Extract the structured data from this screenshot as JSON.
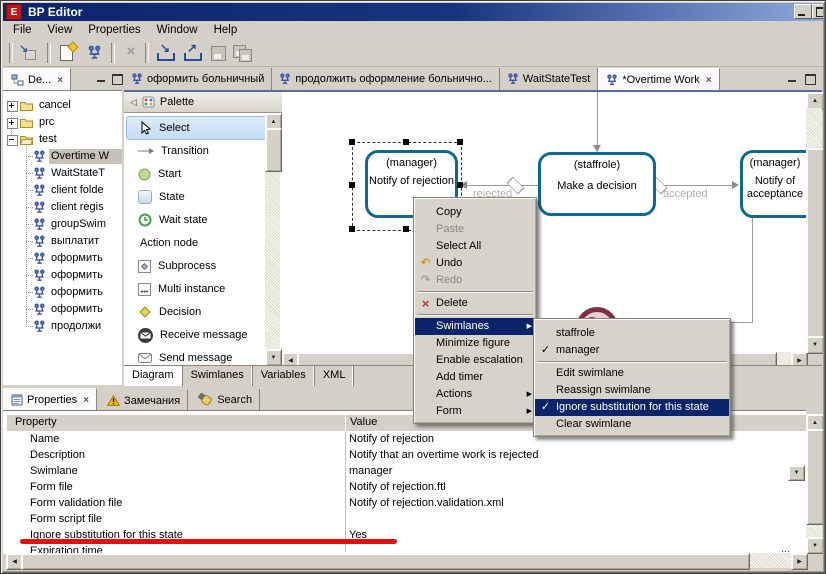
{
  "window": {
    "title": "BP Editor",
    "icon_text": "E"
  },
  "menubar": {
    "items": [
      "File",
      "View",
      "Properties",
      "Window",
      "Help"
    ]
  },
  "toolbar": {
    "icons": [
      "navigate",
      "new-file",
      "new-process",
      "delete",
      "import",
      "export",
      "save",
      "save-all"
    ]
  },
  "explorer": {
    "tab_label": "De...",
    "items": [
      {
        "label": "cancel",
        "type": "folder"
      },
      {
        "label": "prc",
        "type": "folder"
      },
      {
        "label": "test",
        "type": "folder"
      },
      {
        "label": "Overtime W",
        "type": "process"
      },
      {
        "label": "WaitStateT",
        "type": "process"
      },
      {
        "label": "client folde",
        "type": "process"
      },
      {
        "label": "client regis",
        "type": "process"
      },
      {
        "label": "groupSwim",
        "type": "process"
      },
      {
        "label": "выплатит",
        "type": "process"
      },
      {
        "label": "оформить",
        "type": "process"
      },
      {
        "label": "оформить",
        "type": "process"
      },
      {
        "label": "оформить",
        "type": "process"
      },
      {
        "label": "оформить",
        "type": "process"
      },
      {
        "label": "продолжи",
        "type": "process"
      }
    ]
  },
  "editor": {
    "tabs": [
      {
        "label": "оформить больничный"
      },
      {
        "label": "продолжить оформление больнично..."
      },
      {
        "label": "WaitStateTest"
      },
      {
        "label": "*Overtime Work"
      }
    ],
    "bottom_tabs": [
      {
        "label": "Diagram"
      },
      {
        "label": "Swimlanes"
      },
      {
        "label": "Variables"
      },
      {
        "label": "XML"
      }
    ]
  },
  "palette": {
    "title": "Palette",
    "items": [
      {
        "label": "Select"
      },
      {
        "label": "Transition"
      },
      {
        "label": "Start"
      },
      {
        "label": "State"
      },
      {
        "label": "Wait state"
      },
      {
        "label": "Action node"
      },
      {
        "label": "Subprocess"
      },
      {
        "label": "Multi instance"
      },
      {
        "label": "Decision"
      },
      {
        "label": "Receive message"
      },
      {
        "label": "Send message"
      }
    ]
  },
  "diagram": {
    "nodes": [
      {
        "swimlane": "(manager)",
        "name": "Notify of rejection"
      },
      {
        "swimlane": "(staffrole)",
        "name": "Make a decision"
      },
      {
        "swimlane": "(manager)",
        "name": "Notify of acceptance"
      }
    ],
    "transition_labels": {
      "rejected": "rejected",
      "accepted": "accepted"
    }
  },
  "context_menu": {
    "items": [
      {
        "label": "Copy"
      },
      {
        "label": "Paste"
      },
      {
        "label": "Select All"
      },
      {
        "label": "Undo"
      },
      {
        "label": "Redo"
      },
      {
        "label": "Delete"
      },
      {
        "label": "Swimlanes"
      },
      {
        "label": "Minimize figure"
      },
      {
        "label": "Enable escalation"
      },
      {
        "label": "Add timer"
      },
      {
        "label": "Actions"
      },
      {
        "label": "Form"
      }
    ]
  },
  "swimlanes_submenu": {
    "items": [
      {
        "label": "staffrole"
      },
      {
        "label": "manager"
      },
      {
        "label": "Edit swimlane"
      },
      {
        "label": "Reassign swimlane"
      },
      {
        "label": "Ignore substitution for this state"
      },
      {
        "label": "Clear swimlane"
      }
    ]
  },
  "properties_panel": {
    "tabs": [
      {
        "label": "Properties"
      },
      {
        "label": "Замечания"
      },
      {
        "label": "Search"
      }
    ],
    "columns": {
      "property": "Property",
      "value": "Value"
    },
    "rows": [
      {
        "property": "Name",
        "value": "Notify of rejection"
      },
      {
        "property": "Description",
        "value": "Notify that an overtime work is rejected"
      },
      {
        "property": "Swimlane",
        "value": "manager"
      },
      {
        "property": "Form file",
        "value": "Notify of rejection.ftl"
      },
      {
        "property": "Form validation file",
        "value": "Notify of rejection.validation.xml"
      },
      {
        "property": "Form script file",
        "value": ""
      },
      {
        "property": "Ignore substitution for this state",
        "value": "Yes"
      },
      {
        "property": "Expiration time",
        "value": ""
      }
    ]
  },
  "glyphs": {
    "cross": "×",
    "check": "✓",
    "submenu_arrow": "▶",
    "collapse_arrow": "◁",
    "scroll_up": "▲",
    "scroll_down": "▼",
    "scroll_left": "◀",
    "scroll_right": "▶",
    "undo": "↶",
    "redo": "↷",
    "dropdown": "▼",
    "ellipsis": "...",
    "import_arrow": "↘",
    "export_arrow": "↗"
  },
  "colors": {
    "chrome": "#D4D0C8",
    "title_gradient_start": "#0A246A",
    "title_gradient_end": "#8FA8DC",
    "menu_highlight": "#0A246A",
    "node_border": "#11688E",
    "annotation_red": "#E01010"
  }
}
